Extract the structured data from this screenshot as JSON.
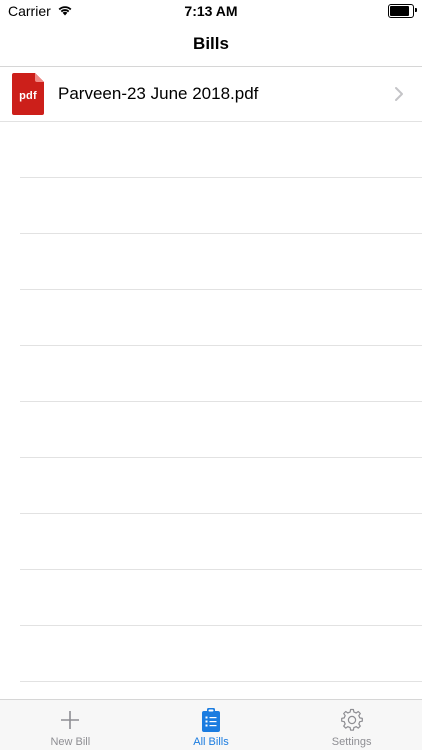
{
  "status_bar": {
    "carrier": "Carrier",
    "time": "7:13 AM",
    "battery_level": 0.85
  },
  "nav": {
    "title": "Bills"
  },
  "files": [
    {
      "name": "Parveen-23 June 2018.pdf",
      "icon_text": "pdf"
    }
  ],
  "empty_rows": 10,
  "tabs": [
    {
      "id": "new-bill",
      "label": "New Bill",
      "icon": "plus-icon",
      "active": false
    },
    {
      "id": "all-bills",
      "label": "All Bills",
      "icon": "clipboard-list-icon",
      "active": true
    },
    {
      "id": "settings",
      "label": "Settings",
      "icon": "gear-icon",
      "active": false
    }
  ],
  "colors": {
    "accent": "#1b7ce0",
    "inactive": "#8e8e93",
    "pdf_red": "#cc1f1a"
  }
}
